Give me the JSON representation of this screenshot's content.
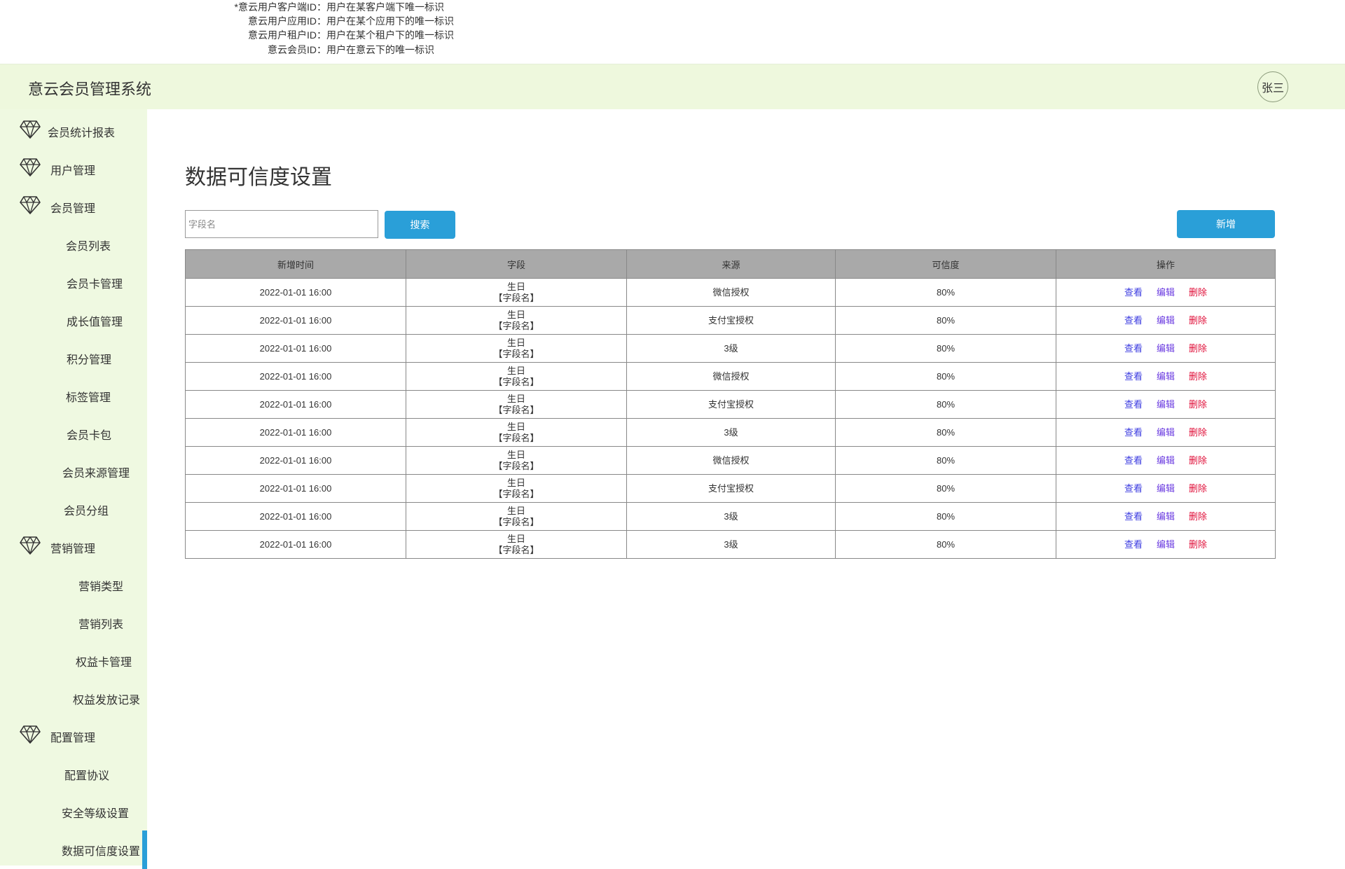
{
  "notes": [
    {
      "key": "*意云用户客户端ID：",
      "value": "用户在某客户端下唯一标识"
    },
    {
      "key": "意云用户应用ID：",
      "value": "用户在某个应用下的唯一标识"
    },
    {
      "key": "意云用户租户ID：",
      "value": "用户在某个租户下的唯一标识"
    },
    {
      "key": "意云会员ID：",
      "value": "用户在意云下的唯一标识"
    }
  ],
  "header": {
    "title": "意云会员管理系统",
    "user": "张三"
  },
  "sidebar": {
    "items": [
      {
        "label": "会员统计报表",
        "group": true
      },
      {
        "label": "用户管理",
        "group": true
      },
      {
        "label": "会员管理",
        "group": true
      },
      {
        "label": "会员列表",
        "group": false
      },
      {
        "label": "会员卡管理",
        "group": false
      },
      {
        "label": "成长值管理",
        "group": false
      },
      {
        "label": "积分管理",
        "group": false
      },
      {
        "label": "标签管理",
        "group": false
      },
      {
        "label": "会员卡包",
        "group": false
      },
      {
        "label": "会员来源管理",
        "group": false
      },
      {
        "label": "会员分组",
        "group": false
      },
      {
        "label": "营销管理",
        "group": true
      },
      {
        "label": "营销类型",
        "group": false
      },
      {
        "label": "营销列表",
        "group": false
      },
      {
        "label": "权益卡管理",
        "group": false
      },
      {
        "label": "权益发放记录",
        "group": false
      },
      {
        "label": "配置管理",
        "group": true
      },
      {
        "label": "配置协议",
        "group": false
      },
      {
        "label": "安全等级设置",
        "group": false
      },
      {
        "label": "数据可信度设置",
        "group": false,
        "active": true
      }
    ]
  },
  "main": {
    "title": "数据可信度设置",
    "search_placeholder": "字段名",
    "search_label": "搜索",
    "add_label": "新增",
    "columns": [
      "新增时间",
      "字段",
      "来源",
      "可信度",
      "操作"
    ],
    "rows": [
      {
        "time": "2022-01-01 16:00",
        "field": "生日",
        "field_name": "【字段名】",
        "source": "微信授权",
        "cred": "80%"
      },
      {
        "time": "2022-01-01 16:00",
        "field": "生日",
        "field_name": "【字段名】",
        "source": "支付宝授权",
        "cred": "80%"
      },
      {
        "time": "2022-01-01 16:00",
        "field": "生日",
        "field_name": "【字段名】",
        "source": "3级",
        "cred": "80%"
      },
      {
        "time": "2022-01-01 16:00",
        "field": "生日",
        "field_name": "【字段名】",
        "source": "微信授权",
        "cred": "80%"
      },
      {
        "time": "2022-01-01 16:00",
        "field": "生日",
        "field_name": "【字段名】",
        "source": "支付宝授权",
        "cred": "80%"
      },
      {
        "time": "2022-01-01 16:00",
        "field": "生日",
        "field_name": "【字段名】",
        "source": "3级",
        "cred": "80%"
      },
      {
        "time": "2022-01-01 16:00",
        "field": "生日",
        "field_name": "【字段名】",
        "source": "微信授权",
        "cred": "80%"
      },
      {
        "time": "2022-01-01 16:00",
        "field": "生日",
        "field_name": "【字段名】",
        "source": "支付宝授权",
        "cred": "80%"
      },
      {
        "time": "2022-01-01 16:00",
        "field": "生日",
        "field_name": "【字段名】",
        "source": "3级",
        "cred": "80%"
      },
      {
        "time": "2022-01-01 16:00",
        "field": "生日",
        "field_name": "【字段名】",
        "source": "3级",
        "cred": "80%"
      }
    ],
    "actions": {
      "view": "查看",
      "edit": "编辑",
      "delete": "删除"
    }
  },
  "colors": {
    "header_bg": "#eef8dd",
    "sidebar_bg": "#eff9e1",
    "accent": "#2a9fd8",
    "table_header": "#a9a9a9",
    "delete": "#e0103a",
    "link": "#3a3ae0"
  }
}
